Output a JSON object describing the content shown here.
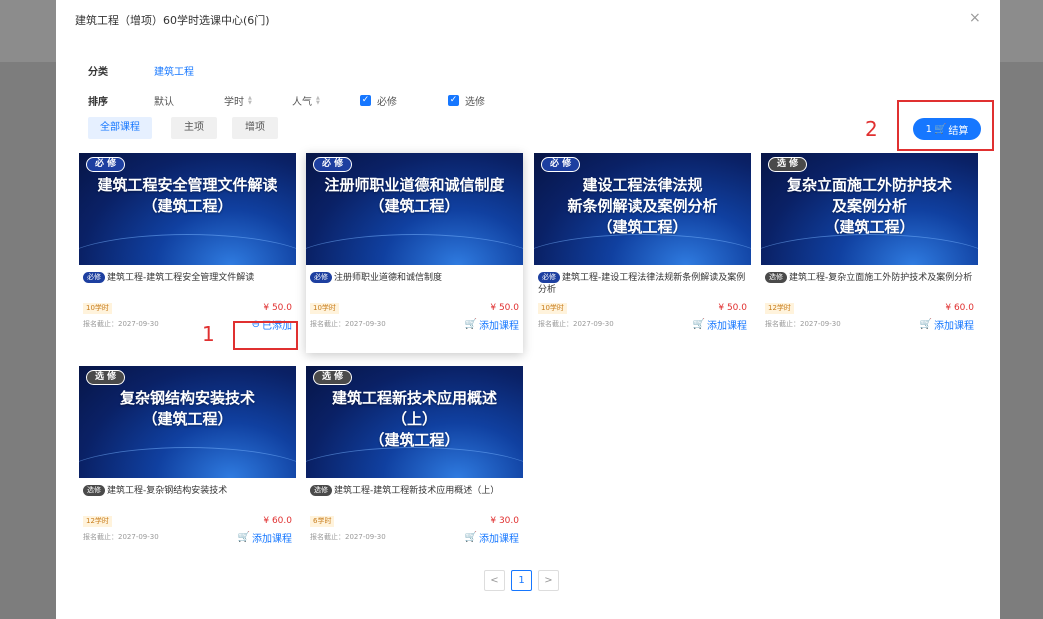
{
  "modal": {
    "title": "建筑工程（增项）60学时选课中心(6门)",
    "close_label": "×"
  },
  "filters": {
    "category_label": "分类",
    "category_value": "建筑工程",
    "sort_label": "排序",
    "sort_default": "默认",
    "sort_hours": "学时",
    "sort_popularity": "人气",
    "required_label": "必修",
    "elective_label": "选修",
    "required_checked": true,
    "elective_checked": true
  },
  "tabs": [
    {
      "label": "全部课程",
      "active": true
    },
    {
      "label": "主项",
      "active": false
    },
    {
      "label": "增项",
      "active": false
    }
  ],
  "checkout": {
    "count": "1",
    "label": "结算"
  },
  "annotations": {
    "one": "1",
    "two": "2"
  },
  "courses": [
    {
      "badge": "必 修",
      "banner": "建筑工程安全管理文件解读\n（建筑工程）",
      "tag": "必修",
      "name": "建筑工程-建筑工程安全管理文件解读",
      "hours": "10学时",
      "price": "¥ 50.0",
      "deadline": "报名截止：2027-09-30",
      "action": "已添加",
      "added": true
    },
    {
      "badge": "必 修",
      "banner": "注册师职业道德和诚信制度\n（建筑工程）",
      "tag": "必修",
      "name": "注册师职业道德和诚信制度",
      "hours": "10学时",
      "price": "¥ 50.0",
      "deadline": "报名截止：2027-09-30",
      "action": "添加课程",
      "added": false
    },
    {
      "badge": "必 修",
      "banner": "建设工程法律法规\n新条例解读及案例分析\n（建筑工程）",
      "tag": "必修",
      "name": "建筑工程-建设工程法律法规新条例解读及案例分析",
      "hours": "10学时",
      "price": "¥ 50.0",
      "deadline": "报名截止：2027-09-30",
      "action": "添加课程",
      "added": false
    },
    {
      "badge": "选 修",
      "banner": "复杂立面施工外防护技术\n及案例分析\n（建筑工程）",
      "tag": "选修",
      "name": "建筑工程-复杂立面施工外防护技术及案例分析",
      "hours": "12学时",
      "price": "¥ 60.0",
      "deadline": "报名截止：2027-09-30",
      "action": "添加课程",
      "added": false
    },
    {
      "badge": "选 修",
      "banner": "复杂钢结构安装技术\n（建筑工程）",
      "tag": "选修",
      "name": "建筑工程-复杂钢结构安装技术",
      "hours": "12学时",
      "price": "¥ 60.0",
      "deadline": "报名截止：2027-09-30",
      "action": "添加课程",
      "added": false
    },
    {
      "badge": "选 修",
      "banner": "建筑工程新技术应用概述\n（上）\n（建筑工程）",
      "tag": "选修",
      "name": "建筑工程-建筑工程新技术应用概述（上）",
      "hours": "6学时",
      "price": "¥ 30.0",
      "deadline": "报名截止：2027-09-30",
      "action": "添加课程",
      "added": false
    }
  ],
  "pagination": {
    "prev": "<",
    "current": "1",
    "next": ">"
  },
  "colors": {
    "accent": "#1677ff",
    "price": "#e03030",
    "annotation": "#e03030"
  }
}
